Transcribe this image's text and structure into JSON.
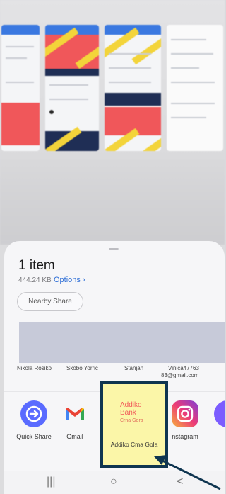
{
  "share_sheet": {
    "title": "1 item",
    "file_size": "444.24 KB",
    "options_label": "Options",
    "nearby_share_label": "Nearby Share"
  },
  "contacts": [
    {
      "label": "Nikola Rosiko"
    },
    {
      "label": "Skobo Yorric"
    },
    {
      "label": "Stanjan"
    },
    {
      "label": "Vinica47763"
    },
    {
      "label": "83@gmail.com"
    }
  ],
  "apps": [
    {
      "label": "Quick Share",
      "icon": "quick-share-icon"
    },
    {
      "label": "Gmail",
      "icon": "gmail-icon"
    },
    {
      "label": "Addiko Cma Gola",
      "icon": "addiko-bank-icon"
    },
    {
      "label": "nstagram",
      "icon": "instagram-icon"
    }
  ],
  "addiko_logo": {
    "line1": "Addiko",
    "line2": "Bank",
    "line3": "Crna Gora"
  },
  "navigation": {
    "recents": "|||",
    "home": "○",
    "back": "<"
  },
  "colors": {
    "highlight_border": "#0f3550",
    "highlight_fill": "#fbf6a8",
    "link": "#2f6fd6",
    "brand_red": "#f15a5a"
  }
}
